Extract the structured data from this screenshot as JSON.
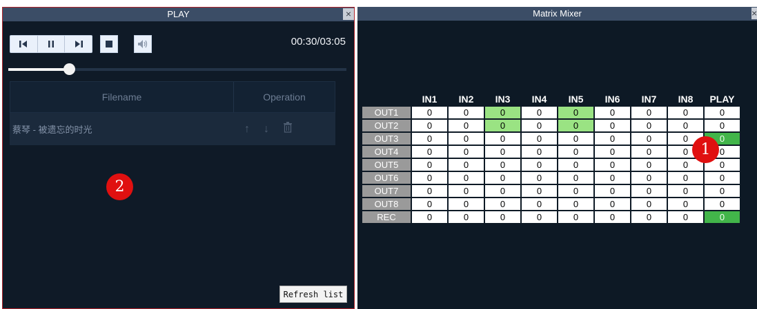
{
  "play": {
    "title": "PLAY",
    "close_glyph": "×",
    "time": "00:30/03:05",
    "progress": 0.18,
    "controls": [
      "previous-icon",
      "pause-icon",
      "next-icon",
      "stop-icon",
      "volume-icon"
    ],
    "table": {
      "col_filename": "Filename",
      "col_operation": "Operation",
      "rows": [
        {
          "filename": "蔡琴 - 被遗忘的时光",
          "op_icons": [
            "↑",
            "↓",
            "🗑"
          ]
        }
      ]
    },
    "refresh_label": "Refresh list",
    "callout": "2"
  },
  "mixer": {
    "title": "Matrix Mixer",
    "close_glyph": "×",
    "columns": [
      "IN1",
      "IN2",
      "IN3",
      "IN4",
      "IN5",
      "IN6",
      "IN7",
      "IN8",
      "PLAY"
    ],
    "rows": [
      {
        "label": "OUT1",
        "values": [
          "0",
          "0",
          "0",
          "0",
          "0",
          "0",
          "0",
          "0",
          "0"
        ],
        "highlight": [
          2,
          4
        ]
      },
      {
        "label": "OUT2",
        "values": [
          "0",
          "0",
          "0",
          "0",
          "0",
          "0",
          "0",
          "0",
          "0"
        ],
        "highlight": [
          2,
          4
        ]
      },
      {
        "label": "OUT3",
        "values": [
          "0",
          "0",
          "0",
          "0",
          "0",
          "0",
          "0",
          "0",
          "0"
        ],
        "highlight": [
          8
        ],
        "strong": true
      },
      {
        "label": "OUT4",
        "values": [
          "0",
          "0",
          "0",
          "0",
          "0",
          "0",
          "0",
          "0",
          "0"
        ],
        "highlight": []
      },
      {
        "label": "OUT5",
        "values": [
          "0",
          "0",
          "0",
          "0",
          "0",
          "0",
          "0",
          "0",
          "0"
        ],
        "highlight": []
      },
      {
        "label": "OUT6",
        "values": [
          "0",
          "0",
          "0",
          "0",
          "0",
          "0",
          "0",
          "0",
          "0"
        ],
        "highlight": []
      },
      {
        "label": "OUT7",
        "values": [
          "0",
          "0",
          "0",
          "0",
          "0",
          "0",
          "0",
          "0",
          "0"
        ],
        "highlight": []
      },
      {
        "label": "OUT8",
        "values": [
          "0",
          "0",
          "0",
          "0",
          "0",
          "0",
          "0",
          "0",
          "0"
        ],
        "highlight": []
      },
      {
        "label": "REC",
        "values": [
          "0",
          "0",
          "0",
          "0",
          "0",
          "0",
          "0",
          "0",
          "0"
        ],
        "highlight": [
          8
        ],
        "strong": true
      }
    ],
    "callout": "1"
  },
  "colors": {
    "highlight_light": "#9ae383",
    "highlight_strong": "#42b54a",
    "callout": "#e01010",
    "panel_border": "#b0222a"
  }
}
